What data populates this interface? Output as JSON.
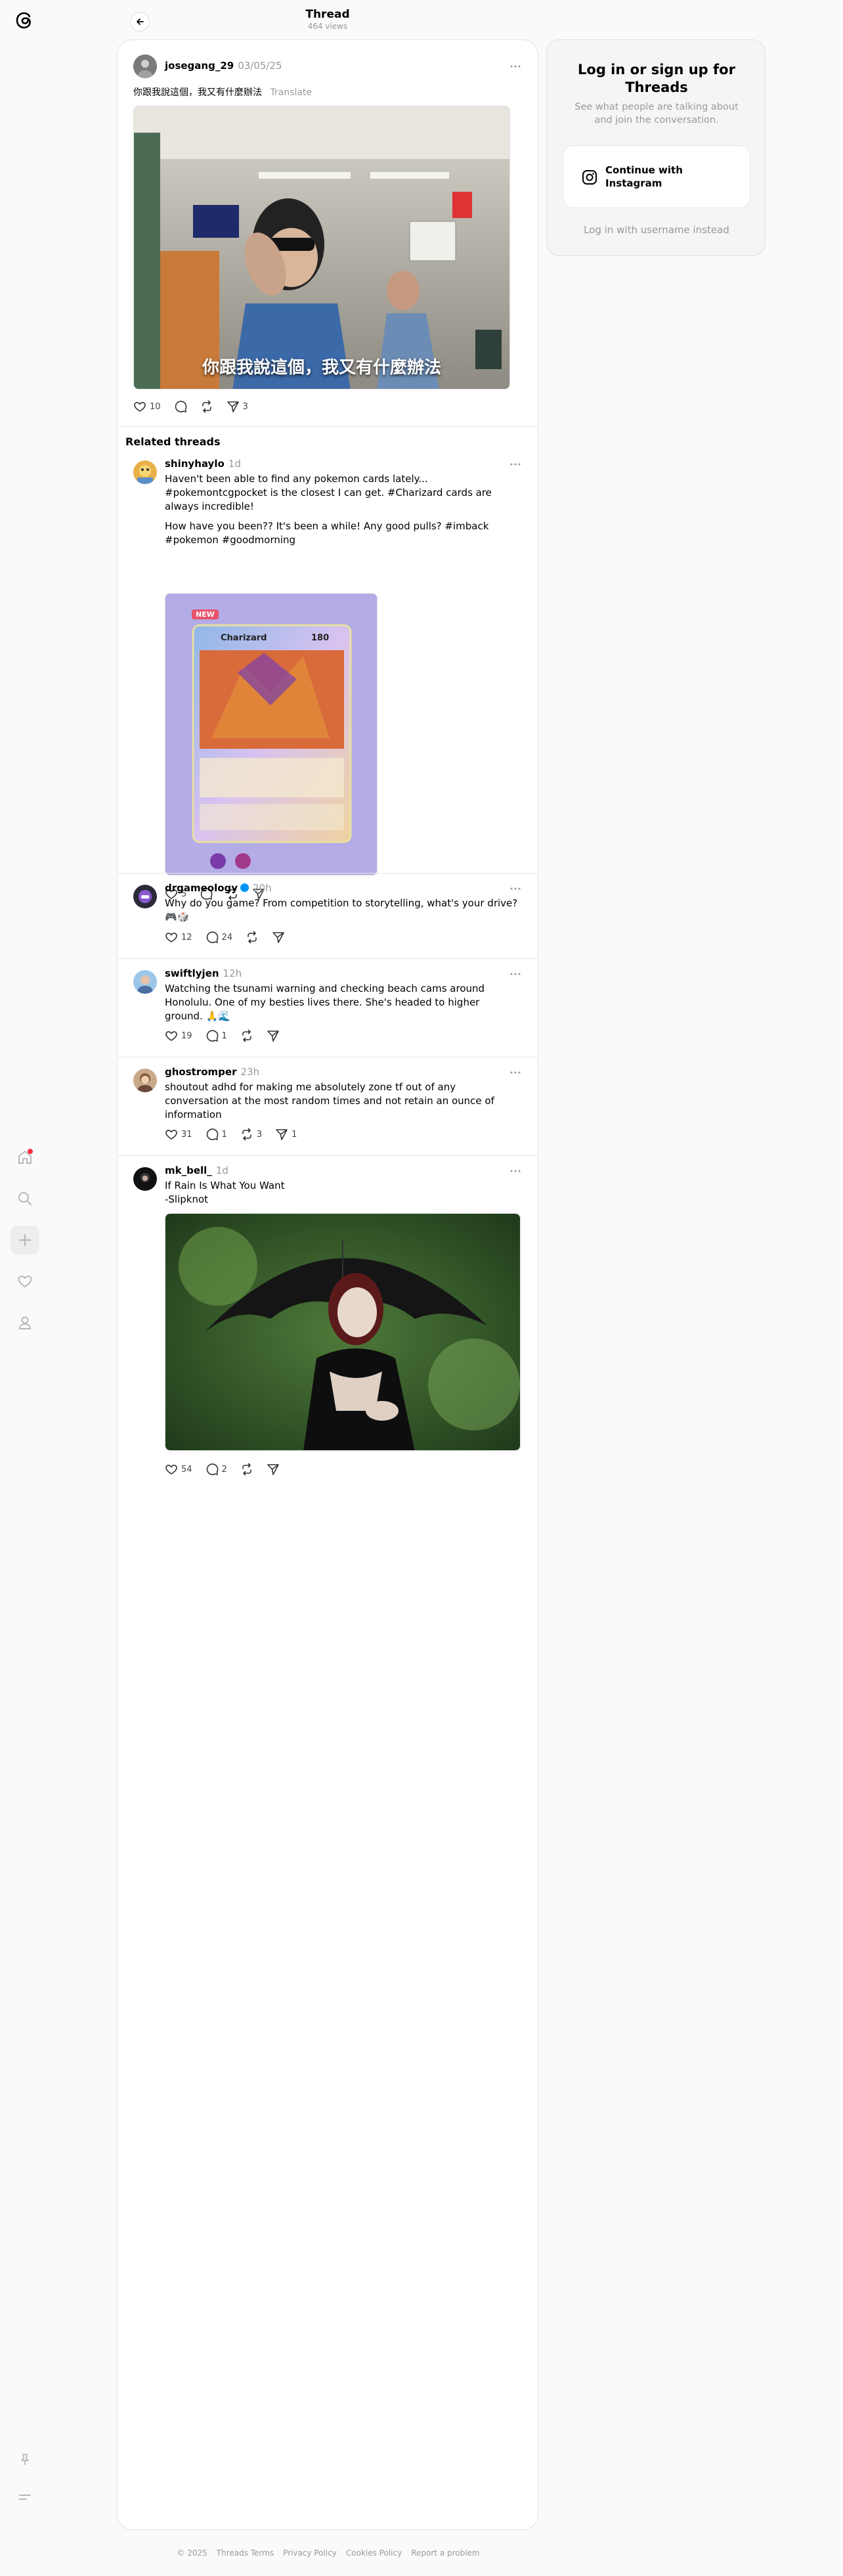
{
  "header": {
    "title": "Thread",
    "subtitle": "464 views"
  },
  "main_post": {
    "username": "josegang_29",
    "date": "03/05/25",
    "text": "你跟我說這個，我又有什麼辦法",
    "translate": "Translate",
    "video_caption": "你跟我說這個，我又有什麼辦法",
    "likes": "10",
    "shares": "3"
  },
  "related_heading": "Related threads",
  "posts": [
    {
      "username": "shinyhaylo",
      "time": "1d",
      "text1": "Haven't been able to find any pokemon cards lately... #pokemontcgpocket is the closest I can get. #Charizard cards are always incredible!",
      "text2": "How have you been?? It's been a while! Any good pulls? #imback #pokemon #goodmorning",
      "card_badge": "NEW",
      "card_name": "Charizard",
      "card_hp": "180",
      "likes": "5"
    },
    {
      "username": "drgameology",
      "time": "20h",
      "text1": "Why do you game? From competition to storytelling, what's your drive? 🎮🎲",
      "likes": "12",
      "replies": "24"
    },
    {
      "username": "swiftlyjen",
      "time": "12h",
      "text1": "Watching the tsunami warning and checking beach cams around Honolulu. One of my besties lives there. She's headed to higher ground. 🙏🌊",
      "likes": "19",
      "replies": "1"
    },
    {
      "username": "ghostromper",
      "time": "23h",
      "text1": "shoutout adhd for making me absolutely zone tf out of any conversation at the most random times and not retain an ounce of information",
      "likes": "31",
      "replies": "1",
      "reposts": "3",
      "shares": "1"
    },
    {
      "username": "mk_bell_",
      "time": "1d",
      "text1": "If Rain Is What You Want",
      "text2": "-Slipknot",
      "likes": "54",
      "replies": "2"
    }
  ],
  "login": {
    "title": "Log in or sign up for Threads",
    "subtitle": "See what people are talking about and join the conversation.",
    "button": "Continue with Instagram",
    "link": "Log in with username instead"
  },
  "footer": {
    "copyright": "© 2025",
    "links": [
      "Threads Terms",
      "Privacy Policy",
      "Cookies Policy",
      "Report a problem"
    ]
  },
  "colors": {
    "accent_blue": "#0095f6",
    "notification_red": "#ff3040",
    "muted_text": "#999999"
  }
}
